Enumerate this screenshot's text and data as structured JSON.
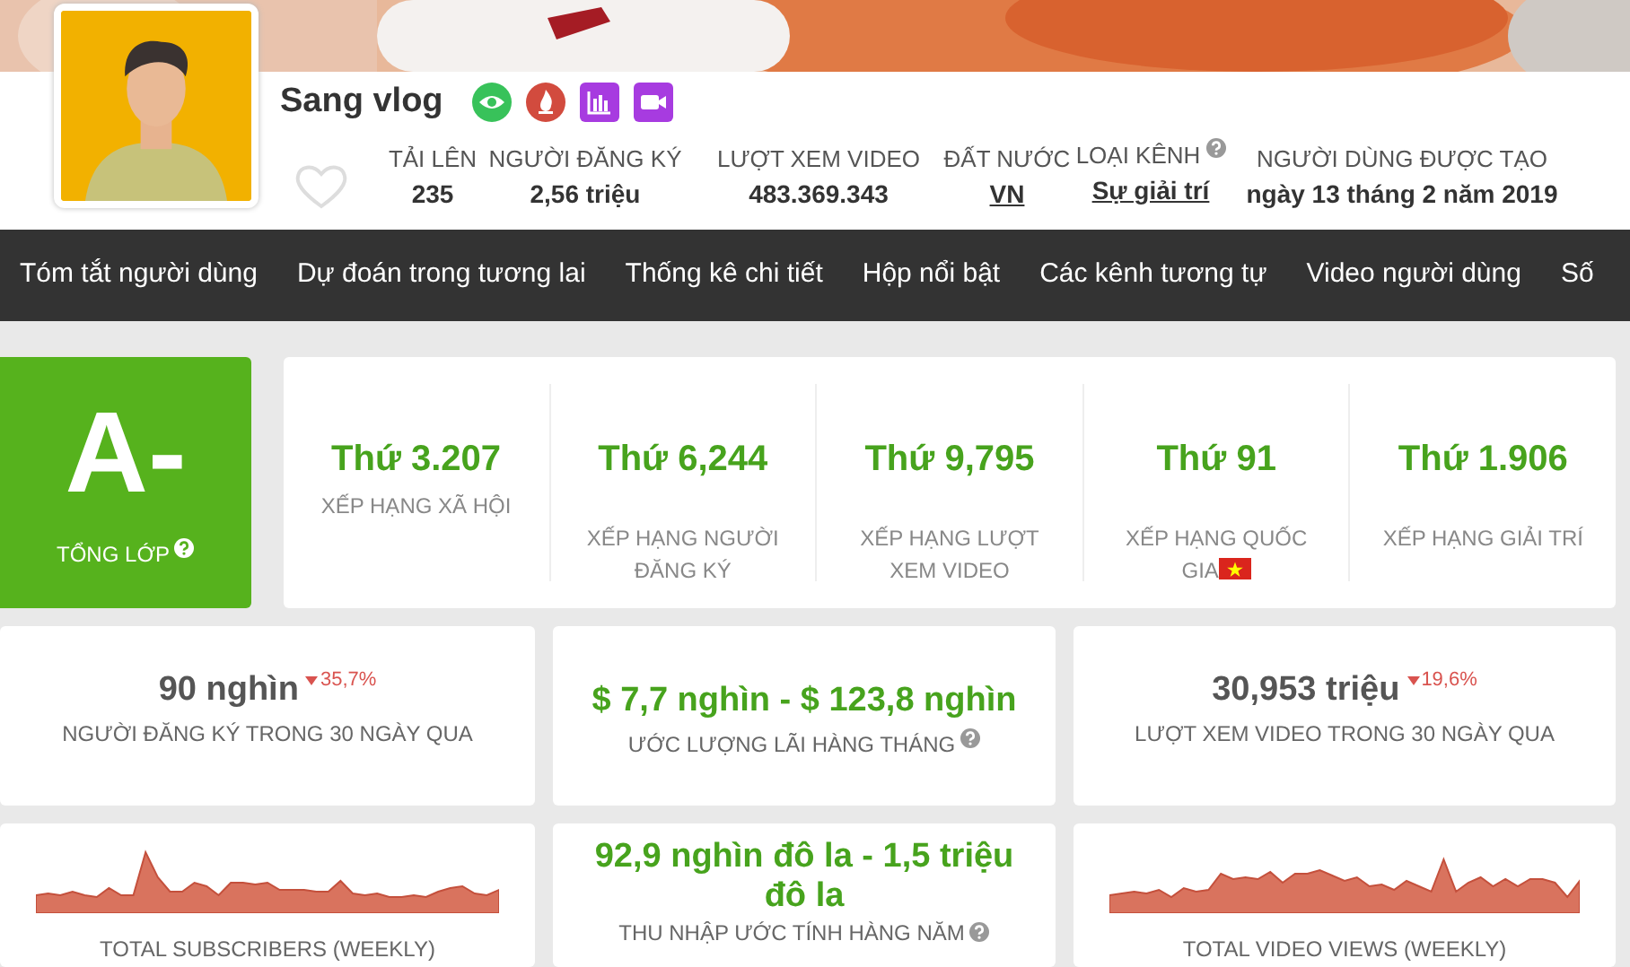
{
  "channel": {
    "name": "Sang vlog",
    "stats": [
      {
        "label": "TẢI LÊN",
        "value": "235",
        "kind": "plain",
        "help": false
      },
      {
        "label": "NGƯỜI ĐĂNG KÝ",
        "value": "2,56 triệu",
        "kind": "plain",
        "help": false
      },
      {
        "label": "LƯỢT XEM VIDEO",
        "value": "483.369.343",
        "kind": "plain",
        "help": false
      },
      {
        "label": "ĐẤT NƯỚC",
        "value": "VN",
        "kind": "link",
        "help": false
      },
      {
        "label": "LOẠI KÊNH",
        "value": "Sự giải trí",
        "kind": "link",
        "help": true
      },
      {
        "label": "NGƯỜI DÙNG ĐƯỢC TẠO",
        "value": "ngày 13 tháng 2 năm 2019",
        "kind": "plain",
        "help": false
      }
    ]
  },
  "nav": [
    {
      "label": "Tóm tắt người dùng"
    },
    {
      "label": "Dự đoán trong tương lai"
    },
    {
      "label": "Thống kê chi tiết"
    },
    {
      "label": "Hộp nổi bật"
    },
    {
      "label": "Các kênh tương tự"
    },
    {
      "label": "Video người dùng"
    },
    {
      "label": "Số"
    }
  ],
  "grade": {
    "letter": "A-",
    "label": "TỔNG LỚP",
    "help": true
  },
  "ranks": [
    {
      "value": "Thứ 3.207",
      "label": "XẾP HẠNG XÃ HỘI",
      "flag": false
    },
    {
      "value": "Thứ 6,244",
      "label": "XẾP HẠNG NGƯỜI ĐĂNG KÝ",
      "flag": false
    },
    {
      "value": "Thứ 9,795",
      "label": "XẾP HẠNG LƯỢT XEM VIDEO",
      "flag": false
    },
    {
      "value": "Thứ 91",
      "label": "XẾP HẠNG QUỐC GIA",
      "flag": true
    },
    {
      "value": "Thứ 1.906",
      "label": "XẾP HẠNG GIẢI TRÍ",
      "flag": false
    }
  ],
  "summary": [
    {
      "kind": "count",
      "value": "90 nghìn",
      "change": "35,7%",
      "label": "NGƯỜI ĐĂNG KÝ TRONG 30 NGÀY QUA",
      "help": false
    },
    {
      "kind": "money",
      "value": "$ 7,7 nghìn - $ 123,8 nghìn",
      "label": "ƯỚC LƯỢNG LÃI HÀNG THÁNG",
      "help": true
    },
    {
      "kind": "count",
      "value": "30,953 triệu",
      "change": "19,6%",
      "label": "LƯỢT XEM VIDEO TRONG 30 NGÀY QUA",
      "help": false
    }
  ],
  "trends": [
    {
      "kind": "sparkline",
      "caption": "TOTAL SUBSCRIBERS (WEEKLY)"
    },
    {
      "kind": "money",
      "value": "92,9 nghìn đô la - 1,5 triệu đô la",
      "label": "THU NHẬP ƯỚC TÍNH HÀNG NĂM",
      "help": true
    },
    {
      "kind": "sparkline",
      "caption": "TOTAL VIDEO VIEWS (WEEKLY)"
    }
  ]
}
